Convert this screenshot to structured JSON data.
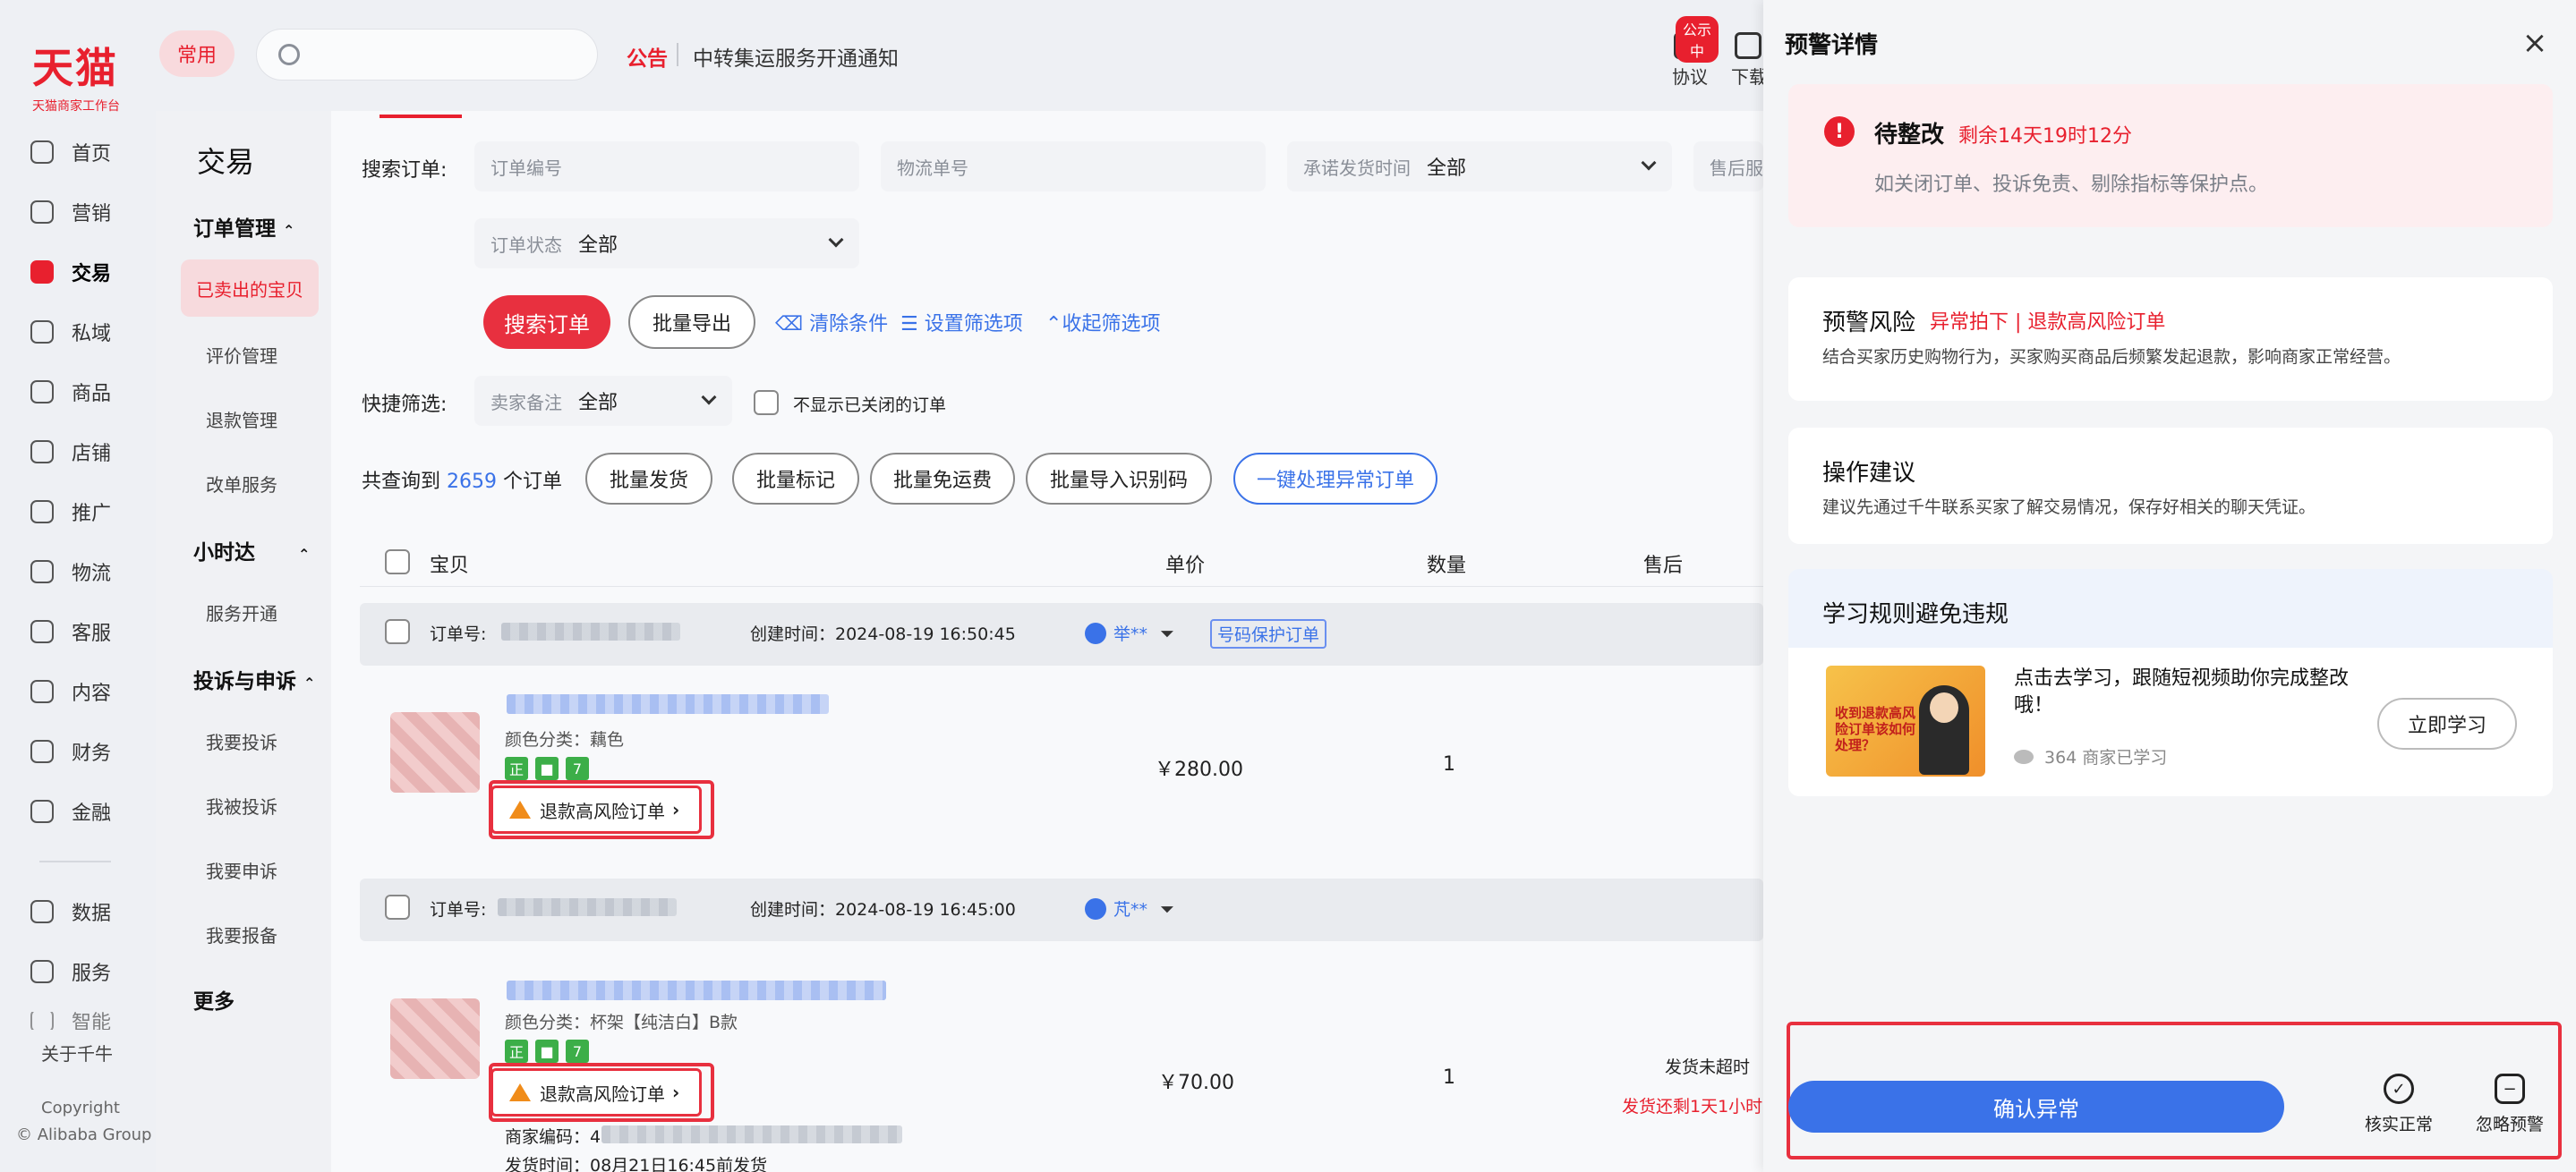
{
  "brand": {
    "logo": "天猫",
    "sub": "天猫商家工作台"
  },
  "nav": {
    "items": [
      {
        "label": "首页",
        "icon": "home-icon"
      },
      {
        "label": "营销",
        "icon": "megaphone-icon"
      },
      {
        "label": "交易",
        "icon": "trade-icon"
      },
      {
        "label": "私域",
        "icon": "users-icon"
      },
      {
        "label": "商品",
        "icon": "bag-icon"
      },
      {
        "label": "店铺",
        "icon": "store-icon"
      },
      {
        "label": "推广",
        "icon": "pin-icon"
      },
      {
        "label": "物流",
        "icon": "truck-icon"
      },
      {
        "label": "客服",
        "icon": "headset-icon"
      },
      {
        "label": "内容",
        "icon": "hash-icon"
      },
      {
        "label": "财务",
        "icon": "yen-icon"
      },
      {
        "label": "金融",
        "icon": "coin-icon"
      },
      {
        "label": "数据",
        "icon": "chart-icon"
      },
      {
        "label": "服务",
        "icon": "grid-icon"
      },
      {
        "label": "智能",
        "icon": "spark-icon"
      }
    ],
    "about": "关于千牛",
    "copyright": "Copyright",
    "company": "© Alibaba Group"
  },
  "topbar": {
    "chip": "常用",
    "notice_tag": "公告",
    "notice_text": "中转集运服务开通通知",
    "protocol": "协议",
    "protocol_badge": "公示中",
    "download": "下载"
  },
  "submenu": {
    "title": "交易",
    "group1": "订单管理",
    "items1": [
      "已卖出的宝贝",
      "评价管理",
      "退款管理",
      "改单服务"
    ],
    "group2": "小时达",
    "items2": [
      "服务开通"
    ],
    "group3": "投诉与申诉",
    "items3": [
      "我要投诉",
      "我被投诉",
      "我要申诉",
      "我要报备"
    ],
    "more": "更多"
  },
  "filters": {
    "search_label": "搜索订单:",
    "order_no": "订单编号",
    "logistics_no": "物流单号",
    "promise_label": "承诺发货时间",
    "promise_val": "全部",
    "aftersale": "售后服务",
    "status_label": "订单状态",
    "status_val": "全部",
    "search_btn": "搜索订单",
    "export_btn": "批量导出",
    "clear": "清除条件",
    "setting": "设置筛选项",
    "collapse": "收起筛选项",
    "quick_label": "快捷筛选:",
    "memo_label": "卖家备注",
    "memo_val": "全部",
    "hide_closed": "不显示已关闭的订单"
  },
  "summary": {
    "prefix": "共查询到",
    "count": "2659",
    "suffix": "个订单",
    "batch": [
      "批量发货",
      "批量标记",
      "批量免运费",
      "批量导入识别码"
    ],
    "one_click": "一键处理异常订单"
  },
  "table": {
    "headers": [
      "宝贝",
      "单价",
      "数量",
      "售后"
    ]
  },
  "orders": [
    {
      "no_label": "订单号:",
      "created": "创建时间：2024-08-19 16:50:45",
      "buyer": "举**",
      "protect": "号码保护订单",
      "color": "颜色分类：藕色",
      "risk": "退款高风险订单",
      "price": "￥280.00",
      "qty": "1"
    },
    {
      "no_label": "订单号:",
      "created": "创建时间：2024-08-19 16:45:00",
      "buyer": "芃**",
      "color": "颜色分类：杯架【纯洁白】B款",
      "risk": "退款高风险订单",
      "price": "￥70.00",
      "qty": "1",
      "ship_status": "发货未超时",
      "ship_left": "发货还剩1天1小时",
      "merchant_code": "商家编码：4",
      "ship_time": "发货时间：08月21日16:45前发货"
    }
  ],
  "panel": {
    "title": "预警详情",
    "status": "待整改",
    "countdown": "剩余14天19时12分",
    "status_desc": "如关闭订单、投诉免责、剔除指标等保护点。",
    "risk_title": "预警风险",
    "risk_type": "异常拍下 | 退款高风险订单",
    "risk_desc": "结合买家历史购物行为，买家购买商品后频繁发起退款，影响商家正常经营。",
    "advice_title": "操作建议",
    "advice_desc": "建议先通过千牛联系买家了解交易情况，保存好相关的聊天凭证。",
    "learn_title": "学习规则避免违规",
    "learn_text": "点击去学习，跟随短视频助你完成整改哦！",
    "learn_count": "364 商家已学习",
    "learn_btn": "立即学习",
    "promo_text": "收到退款高风险订单该如何处理？",
    "confirm": "确认异常",
    "verify": "核实正常",
    "ignore": "忽略预警"
  },
  "colors": {
    "brand_red": "#e8202e",
    "accent_blue": "#3a72e8"
  }
}
